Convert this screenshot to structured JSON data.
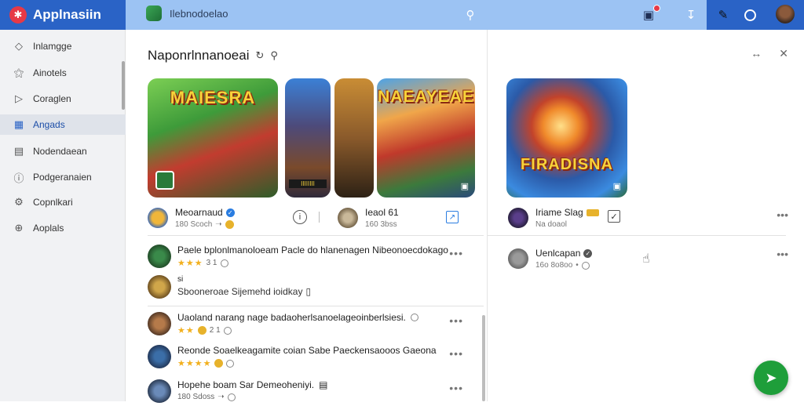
{
  "app": {
    "name": "Applnasiin"
  },
  "header": {
    "app_title": "Ilebnodoelao"
  },
  "sidebar": {
    "items": [
      {
        "label": "Inlamgge",
        "icon": "tag-icon"
      },
      {
        "label": "Ainotels",
        "icon": "flask-icon"
      },
      {
        "label": "Coraglen",
        "icon": "tag-icon"
      },
      {
        "label": "Angads",
        "icon": "grid-icon",
        "active": true
      },
      {
        "label": "Nodendaean",
        "icon": "card-icon"
      },
      {
        "label": "Podgeranaien",
        "icon": "info-icon"
      },
      {
        "label": "Copnlkari",
        "icon": "gear-icon"
      },
      {
        "label": "Aoplals",
        "icon": "plus-icon"
      }
    ]
  },
  "main": {
    "title": "Naponrlnnanoeai",
    "thumbnails": [
      {
        "title": "MAIESRA"
      },
      {
        "title": "",
        "tag": "IIIIIIII"
      },
      {
        "title": ""
      },
      {
        "title": "NAEAYEAE"
      }
    ],
    "author_left": {
      "name": "Meoarnaud",
      "meta": "180 Scoch"
    },
    "author_right": {
      "name": "Ieaol 61",
      "meta": "160 3bss"
    },
    "comments": [
      {
        "text": "Paele bplonlmanoloeam Pacle do hlanenagen Nibeonoecdokago",
        "rating": "★★★",
        "meta": "3 1"
      },
      {
        "text": "si",
        "meta": "Sbooneroae Sijemehd ioidkay"
      },
      {
        "text": "Uaoland narang nage badaoherlsanoelageoinberlsiesi.",
        "rating": "★★",
        "meta": "2 1"
      },
      {
        "text": "Reonde Soaelkeagamite coian Sabe Paeckensaooos Gaeona",
        "rating": "★★★★",
        "meta": ""
      },
      {
        "text": "Hopehe boam Sar Demeoheniyi.",
        "meta": "180 Sdoss"
      }
    ]
  },
  "right_panel": {
    "thumbnail_title": "FIRADISNA",
    "author1": {
      "name": "Iriame Slag",
      "meta": "Na doaol"
    },
    "author2": {
      "name": "Uenlcapan",
      "meta": "16o 8o8oo"
    }
  },
  "colors": {
    "accent": "#2a63c6",
    "topbar": "#9cc3f3",
    "fab": "#1e9e3a",
    "star": "#f2b01e",
    "verified": "#2a7de1"
  }
}
